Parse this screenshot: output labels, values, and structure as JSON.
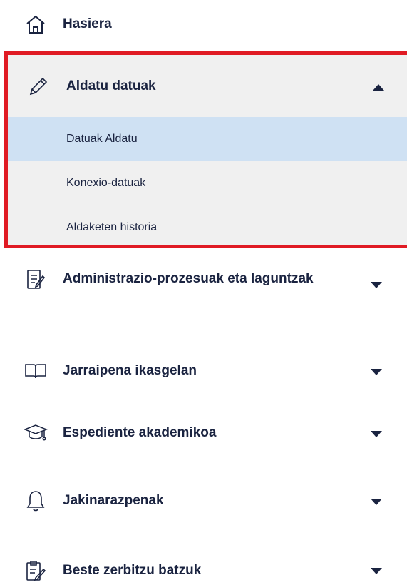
{
  "menu": {
    "home_label": "Hasiera",
    "expanded": {
      "label": "Aldatu datuak",
      "items": [
        {
          "label": "Datuak Aldatu",
          "active": true
        },
        {
          "label": "Konexio-datuak",
          "active": false
        },
        {
          "label": "Aldaketen historia",
          "active": false
        }
      ]
    },
    "items": [
      {
        "label": "Administrazio-prozesuak eta laguntzak",
        "icon": "form-icon"
      },
      {
        "label": "Jarraipena ikasgelan",
        "icon": "book-icon"
      },
      {
        "label": "Espediente akademikoa",
        "icon": "graduation-cap-icon"
      },
      {
        "label": "Jakinarazpenak",
        "icon": "bell-icon"
      },
      {
        "label": "Beste zerbitzu batzuk",
        "icon": "document-edit-icon"
      }
    ]
  }
}
